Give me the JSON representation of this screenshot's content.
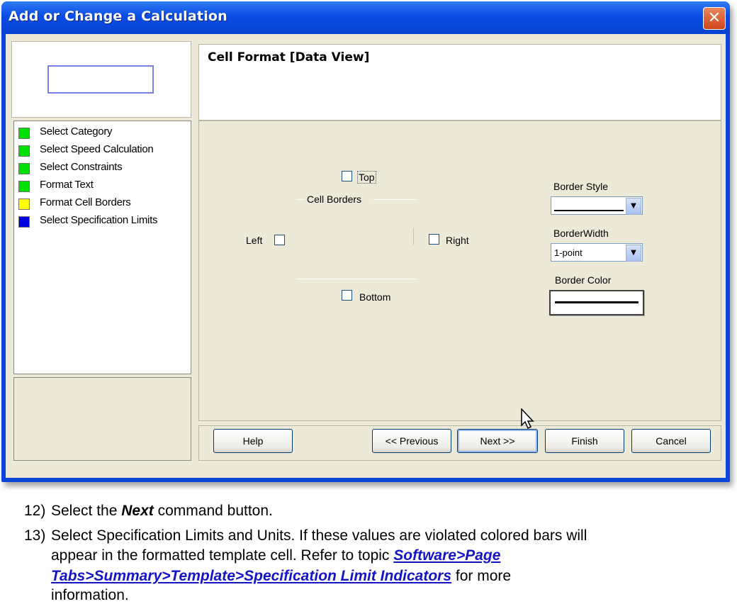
{
  "dialog": {
    "title": "Add or Change a Calculation",
    "close_icon": "close-icon",
    "steps": [
      {
        "label": "Select Category",
        "color": "#00e000"
      },
      {
        "label": "Select Speed Calculation",
        "color": "#00e000"
      },
      {
        "label": "Select Constraints",
        "color": "#00e000"
      },
      {
        "label": "Format Text",
        "color": "#00e000"
      },
      {
        "label": "Format Cell Borders",
        "color": "#ffff00"
      },
      {
        "label": "Select Specification Limits",
        "color": "#0000e0"
      }
    ],
    "section_title": "Cell Format [Data View]",
    "borders": {
      "group_label": "Cell Borders",
      "top_label": "Top",
      "left_label": "Left",
      "right_label": "Right",
      "bottom_label": "Bottom"
    },
    "border_style": {
      "label": "Border Style"
    },
    "border_width": {
      "label": "BorderWidth",
      "value": "1-point"
    },
    "border_color": {
      "label": "Border Color"
    },
    "buttons": {
      "help": "Help",
      "previous": "<< Previous",
      "next": "Next >>",
      "finish": "Finish",
      "cancel": "Cancel"
    }
  },
  "instructions": {
    "step12": {
      "number": "12)",
      "before": "Select the ",
      "emphasis": "Next",
      "after": " command button."
    },
    "step13": {
      "number": "13)",
      "line1": "Select Specification Limits and Units. If these values are violated colored bars will",
      "line2_before": "appear in the formatted template cell. Refer to   topic ",
      "link_part1": "Software>Page ",
      "link_part2": "Tabs>Summary>Template>Specification Limit Indicators",
      "after_link": " for more",
      "line4": "information."
    }
  }
}
